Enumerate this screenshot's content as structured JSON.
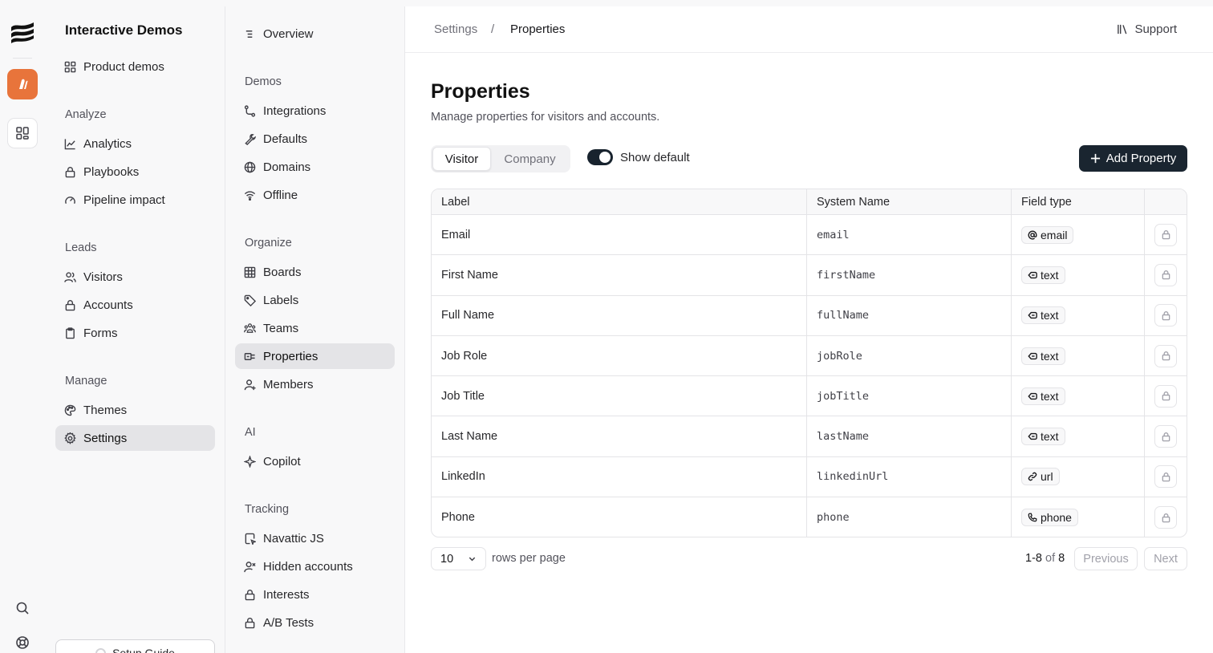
{
  "rail": {
    "icons": [
      "navattic-logo-icon",
      "app-orange-icon",
      "dashboard-grid-icon",
      "search-icon",
      "help-lifebuoy-icon"
    ],
    "accent": "#e8743b"
  },
  "nav1": {
    "title": "Interactive Demos",
    "top_item": "Product demos",
    "sections": [
      {
        "label": "Analyze",
        "items": [
          "Analytics",
          "Playbooks",
          "Pipeline impact"
        ]
      },
      {
        "label": "Leads",
        "items": [
          "Visitors",
          "Accounts",
          "Forms"
        ]
      },
      {
        "label": "Manage",
        "items": [
          "Themes",
          "Settings"
        ]
      }
    ],
    "active": "Settings",
    "setup_guide": "Setup Guide"
  },
  "nav2": {
    "overview": "Overview",
    "sections": [
      {
        "label": "Demos",
        "items": [
          "Integrations",
          "Defaults",
          "Domains",
          "Offline"
        ]
      },
      {
        "label": "Organize",
        "items": [
          "Boards",
          "Labels",
          "Teams",
          "Properties",
          "Members"
        ]
      },
      {
        "label": "AI",
        "items": [
          "Copilot"
        ]
      },
      {
        "label": "Tracking",
        "items": [
          "Navattic JS",
          "Hidden accounts",
          "Interests",
          "A/B Tests"
        ]
      }
    ],
    "active": "Properties"
  },
  "header": {
    "breadcrumb_root": "Settings",
    "breadcrumb_sep": "/",
    "breadcrumb_current": "Properties",
    "support": "Support"
  },
  "page": {
    "title": "Properties",
    "subtitle": "Manage properties for visitors and accounts.",
    "tabs": [
      "Visitor",
      "Company"
    ],
    "active_tab": "Visitor",
    "toggle_label": "Show default",
    "toggle_on": true,
    "add_button": "Add Property"
  },
  "table": {
    "columns": [
      "Label",
      "System Name",
      "Field type",
      ""
    ],
    "rows": [
      {
        "label": "Email",
        "system": "email",
        "type": "email",
        "type_icon": "at-sign-icon"
      },
      {
        "label": "First Name",
        "system": "firstName",
        "type": "text",
        "type_icon": "text-tag-icon"
      },
      {
        "label": "Full Name",
        "system": "fullName",
        "type": "text",
        "type_icon": "text-tag-icon"
      },
      {
        "label": "Job Role",
        "system": "jobRole",
        "type": "text",
        "type_icon": "text-tag-icon"
      },
      {
        "label": "Job Title",
        "system": "jobTitle",
        "type": "text",
        "type_icon": "text-tag-icon"
      },
      {
        "label": "Last Name",
        "system": "lastName",
        "type": "text",
        "type_icon": "text-tag-icon"
      },
      {
        "label": "LinkedIn",
        "system": "linkedinUrl",
        "type": "url",
        "type_icon": "link-icon"
      },
      {
        "label": "Phone",
        "system": "phone",
        "type": "phone",
        "type_icon": "phone-icon"
      }
    ]
  },
  "pagination": {
    "page_size": "10",
    "rows_per_page": "rows per page",
    "range": "1-8",
    "of": "of",
    "total": "8",
    "previous": "Previous",
    "next": "Next"
  }
}
